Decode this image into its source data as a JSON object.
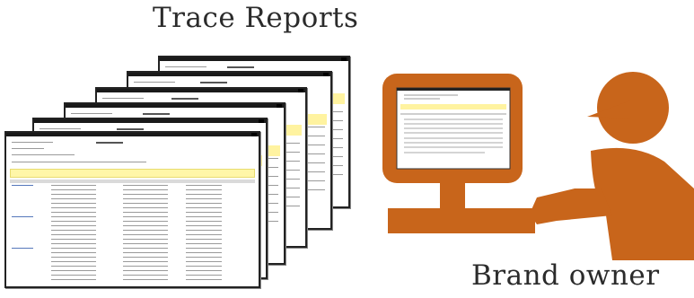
{
  "captions": {
    "trace_reports": "Trace Reports",
    "brand_owner": "Brand owner"
  },
  "colors": {
    "brand_orange": "#C8651B",
    "text": "#2b2b2b",
    "highlight_yellow": "#fff6a8"
  },
  "icons": {
    "report_stack": "stacked-report-pages-icon",
    "person": "brand-owner-person-icon",
    "monitor": "computer-monitor-icon"
  }
}
